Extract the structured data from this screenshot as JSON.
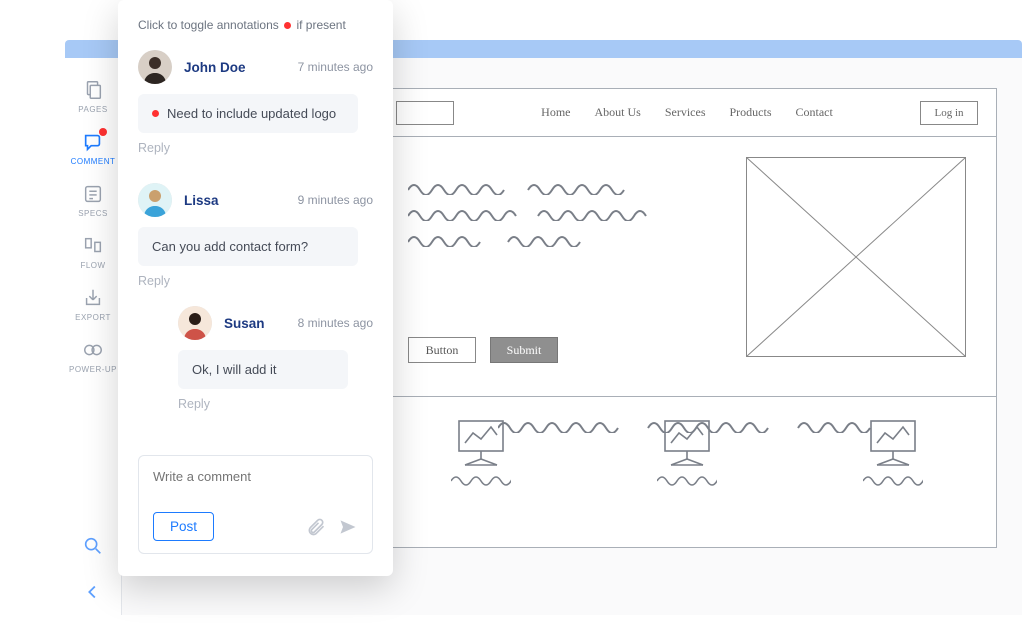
{
  "hint": {
    "prefix": "Click to toggle annotations",
    "suffix": "if present"
  },
  "rail": {
    "items": [
      {
        "label": "PAGES"
      },
      {
        "label": "COMMENT"
      },
      {
        "label": "SPECS"
      },
      {
        "label": "FLOW"
      },
      {
        "label": "EXPORT"
      },
      {
        "label": "POWER-UP"
      }
    ]
  },
  "comments": [
    {
      "user": "John Doe",
      "time": "7 minutes ago",
      "text": "Need to include updated logo",
      "annotated": true,
      "reply_label": "Reply"
    },
    {
      "user": "Lissa",
      "time": "9 minutes ago",
      "text": "Can you add contact form?",
      "annotated": false,
      "reply_label": "Reply",
      "replies": [
        {
          "user": "Susan",
          "time": "8 minutes ago",
          "text": "Ok, I will add it",
          "reply_label": "Reply"
        }
      ]
    }
  ],
  "composer": {
    "placeholder": "Write a comment",
    "post_label": "Post"
  },
  "wireframe": {
    "nav": [
      "Home",
      "About Us",
      "Services",
      "Products",
      "Contact"
    ],
    "login": "Log in",
    "button1": "Button",
    "button2": "Submit"
  }
}
